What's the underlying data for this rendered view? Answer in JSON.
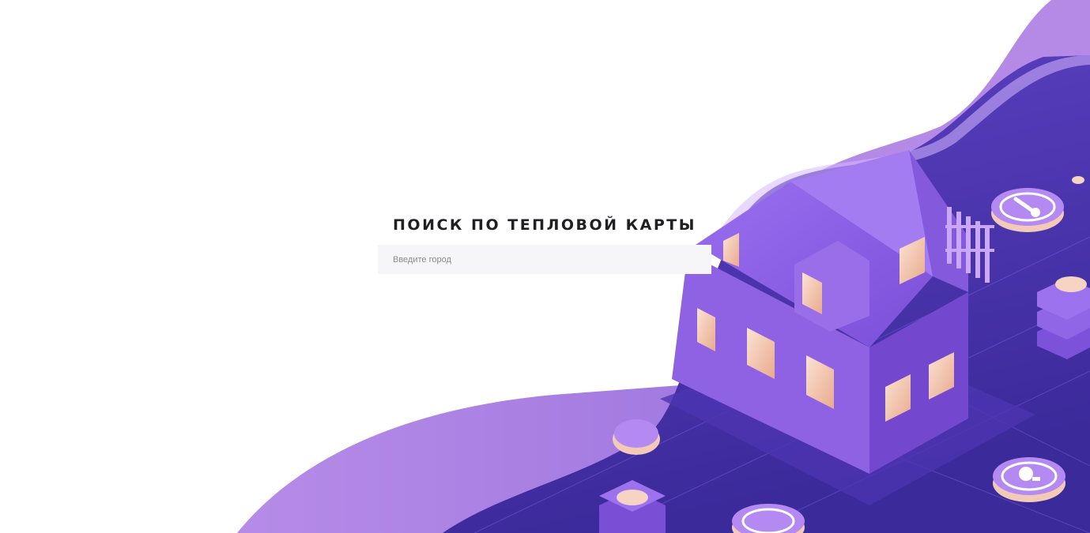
{
  "search": {
    "title": "ПОИСК ПО ТЕПЛОВОЙ КАРТЫ",
    "placeholder": "Введите город",
    "value": ""
  },
  "hero_illustration": {
    "icon": "smart-house-illustration",
    "colors": {
      "wave_light": "#b48ae6",
      "wave_dark": "#6a4ad0",
      "house": "#8c5fe0",
      "window_glow": "#f6c9b8"
    }
  }
}
